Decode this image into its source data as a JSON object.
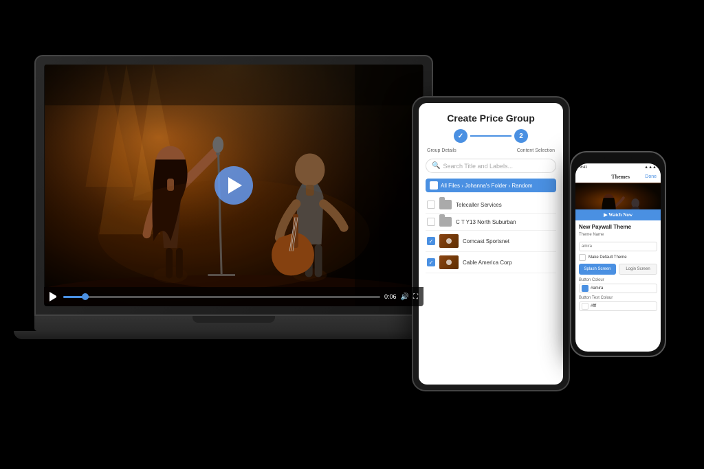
{
  "background": "#000000",
  "laptop": {
    "video": {
      "play_button_label": "play",
      "time_current": "0:06",
      "time_total": "0:06"
    },
    "concert": {
      "description": "Live concert performance with singer and guitarist on stage"
    }
  },
  "tablet": {
    "title": "Create Price Group",
    "steps": [
      {
        "label": "Group Details",
        "number": "1",
        "state": "done"
      },
      {
        "label": "Content Selection",
        "number": "2",
        "state": "active"
      }
    ],
    "search_placeholder": "Search Title and Labels...",
    "breadcrumb": "All Files › Johanna's Folder › Random",
    "files": [
      {
        "name": "Telecaller Services",
        "type": "folder",
        "checked": false
      },
      {
        "name": "C T Y13 North Suburban",
        "type": "folder",
        "checked": false
      },
      {
        "name": "Comcast Sportsnet",
        "type": "video",
        "checked": true
      },
      {
        "name": "Cable America Corp",
        "type": "video",
        "checked": true
      }
    ]
  },
  "phone": {
    "status_time": "9:41",
    "status_icons": "◼◼◼",
    "header_title": "Themes",
    "header_button": "Done",
    "section_title": "New Paywall Theme",
    "fields": {
      "theme_name_label": "Theme Name",
      "theme_name_placeholder": "amira",
      "make_default_label": "Make Default Theme",
      "button_color_label": "Button Colour",
      "button_color_value": "#amira",
      "button_text_color_label": "Button Text Colour",
      "button_text_color_value": "#fff"
    },
    "toggle_buttons": [
      {
        "label": "Splash Screen",
        "active": true
      },
      {
        "label": "Login Screen",
        "active": false
      }
    ]
  }
}
